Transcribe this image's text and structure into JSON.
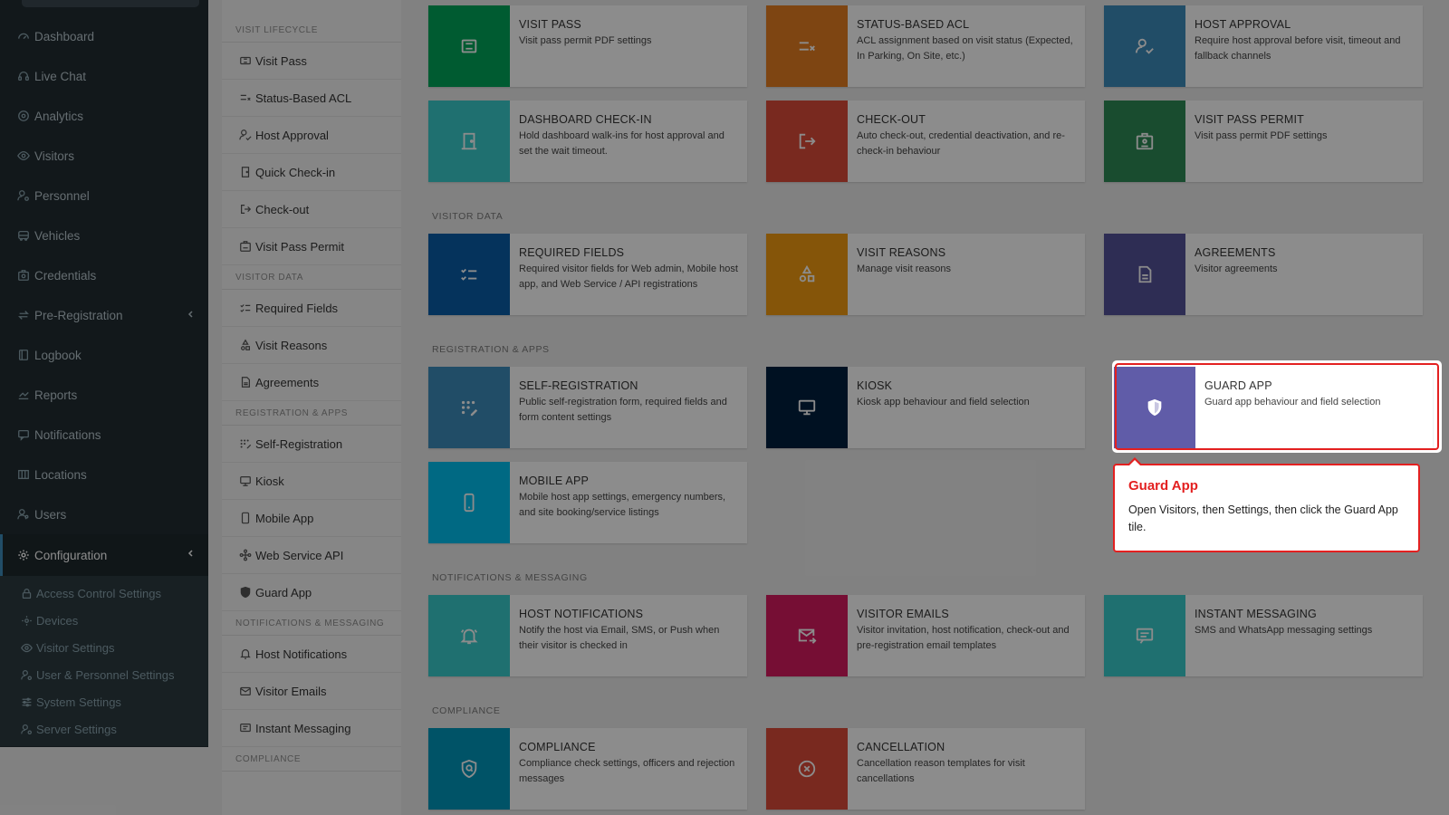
{
  "sidebar": {
    "items": [
      {
        "label": "Dashboard",
        "icon": "dashboard-icon"
      },
      {
        "label": "Live Chat",
        "icon": "headset-icon"
      },
      {
        "label": "Analytics",
        "icon": "target-icon"
      },
      {
        "label": "Visitors",
        "icon": "eye-icon"
      },
      {
        "label": "Personnel",
        "icon": "user-gear-icon"
      },
      {
        "label": "Vehicles",
        "icon": "bus-icon"
      },
      {
        "label": "Credentials",
        "icon": "id-card-icon"
      },
      {
        "label": "Pre-Registration",
        "icon": "swap-icon"
      },
      {
        "label": "Logbook",
        "icon": "book-icon"
      },
      {
        "label": "Reports",
        "icon": "chart-icon"
      },
      {
        "label": "Notifications",
        "icon": "message-icon"
      },
      {
        "label": "Locations",
        "icon": "map-icon"
      },
      {
        "label": "Users",
        "icon": "users-icon"
      },
      {
        "label": "Configuration",
        "icon": "cog-icon"
      }
    ],
    "sub_items": [
      {
        "label": "Access Control Settings",
        "icon": "lock-icon"
      },
      {
        "label": "Devices",
        "icon": "cog-icon"
      },
      {
        "label": "Visitor Settings",
        "icon": "eye-icon"
      },
      {
        "label": "User & Personnel Settings",
        "icon": "user-gear-icon"
      },
      {
        "label": "System Settings",
        "icon": "sliders-icon"
      },
      {
        "label": "Server Settings",
        "icon": "server-cog-icon"
      }
    ]
  },
  "settings_menu": {
    "sections": [
      {
        "title": "VISIT LIFECYCLE",
        "items": [
          "Visit Pass",
          "Status-Based ACL",
          "Host Approval",
          "Quick Check-in",
          "Check-out",
          "Visit Pass Permit"
        ]
      },
      {
        "title": "VISITOR DATA",
        "items": [
          "Required Fields",
          "Visit Reasons",
          "Agreements"
        ]
      },
      {
        "title": "REGISTRATION & APPS",
        "items": [
          "Self-Registration",
          "Kiosk",
          "Mobile App",
          "Web Service API",
          "Guard App"
        ]
      },
      {
        "title": "NOTIFICATIONS & MESSAGING",
        "items": [
          "Host Notifications",
          "Visitor Emails",
          "Instant Messaging"
        ]
      },
      {
        "title": "COMPLIANCE",
        "items": []
      }
    ]
  },
  "tile_sections": [
    "VISITOR DATA",
    "REGISTRATION & APPS",
    "NOTIFICATIONS & MESSAGING",
    "COMPLIANCE"
  ],
  "tiles": [
    {
      "title": "VISIT PASS",
      "desc": "Visit pass permit PDF settings",
      "color": "#00a65a",
      "icon": "ticket-icon"
    },
    {
      "title": "STATUS-BASED ACL",
      "desc": "ACL assignment based on visit status (Expected, In Parking, On Site, etc.)",
      "color": "#e67e22",
      "icon": "checklist-x-icon"
    },
    {
      "title": "HOST APPROVAL",
      "desc": "Require host approval before visit, timeout and fallback channels",
      "color": "#3c8dbc",
      "icon": "user-check-icon"
    },
    {
      "title": "DASHBOARD CHECK-IN",
      "desc": "Hold dashboard walk-ins for host approval and set the wait timeout.",
      "color": "#39cccc",
      "icon": "door-icon"
    },
    {
      "title": "CHECK-OUT",
      "desc": "Auto check-out, credential deactivation, and re-check-in behaviour",
      "color": "#dd4b39",
      "icon": "logout-icon"
    },
    {
      "title": "VISIT PASS PERMIT",
      "desc": "Visit pass permit PDF settings",
      "color": "#2e8b57",
      "icon": "badge-icon"
    },
    {
      "title": "REQUIRED FIELDS",
      "desc": "Required visitor fields for Web admin, Mobile host app, and Web Service / API registrations",
      "color": "#0a5ea8",
      "icon": "list-check-icon"
    },
    {
      "title": "VISIT REASONS",
      "desc": "Manage visit reasons",
      "color": "#f39c12",
      "icon": "shapes-icon"
    },
    {
      "title": "AGREEMENTS",
      "desc": "Visitor agreements",
      "color": "#555299",
      "icon": "document-icon"
    },
    {
      "title": "SELF-REGISTRATION",
      "desc": "Public self-registration form, required fields and form content settings",
      "color": "#3c8dbc",
      "icon": "grid-edit-icon"
    },
    {
      "title": "KIOSK",
      "desc": "Kiosk app behaviour and field selection",
      "color": "#001f3f",
      "icon": "monitor-icon"
    },
    {
      "title": "GUARD APP",
      "desc": "Guard app behaviour and field selection",
      "color": "#605ca8",
      "icon": "shield-icon"
    },
    {
      "title": "MOBILE APP",
      "desc": "Mobile host app settings, emergency numbers, and site booking/service listings",
      "color": "#00c0ef",
      "icon": "phone-icon"
    },
    {
      "title": "HOST NOTIFICATIONS",
      "desc": "Notify the host via Email, SMS, or Push when their visitor is checked in",
      "color": "#39cccc",
      "icon": "bell-icon"
    },
    {
      "title": "VISITOR EMAILS",
      "desc": "Visitor invitation, host notification, check-out and pre-registration email templates",
      "color": "#d81b60",
      "icon": "mail-send-icon"
    },
    {
      "title": "INSTANT MESSAGING",
      "desc": "SMS and WhatsApp messaging settings",
      "color": "#39cccc",
      "icon": "chat-icon"
    },
    {
      "title": "COMPLIANCE",
      "desc": "Compliance check settings, officers and rejection messages",
      "color": "#0097bc",
      "icon": "shield-search-icon"
    },
    {
      "title": "CANCELLATION",
      "desc": "Cancellation reason templates for visit cancellations",
      "color": "#dd4b39",
      "icon": "x-circle-icon"
    }
  ],
  "tooltip": {
    "title": "Guard App",
    "text": "Open Visitors, then Settings, then click the Guard App tile."
  }
}
